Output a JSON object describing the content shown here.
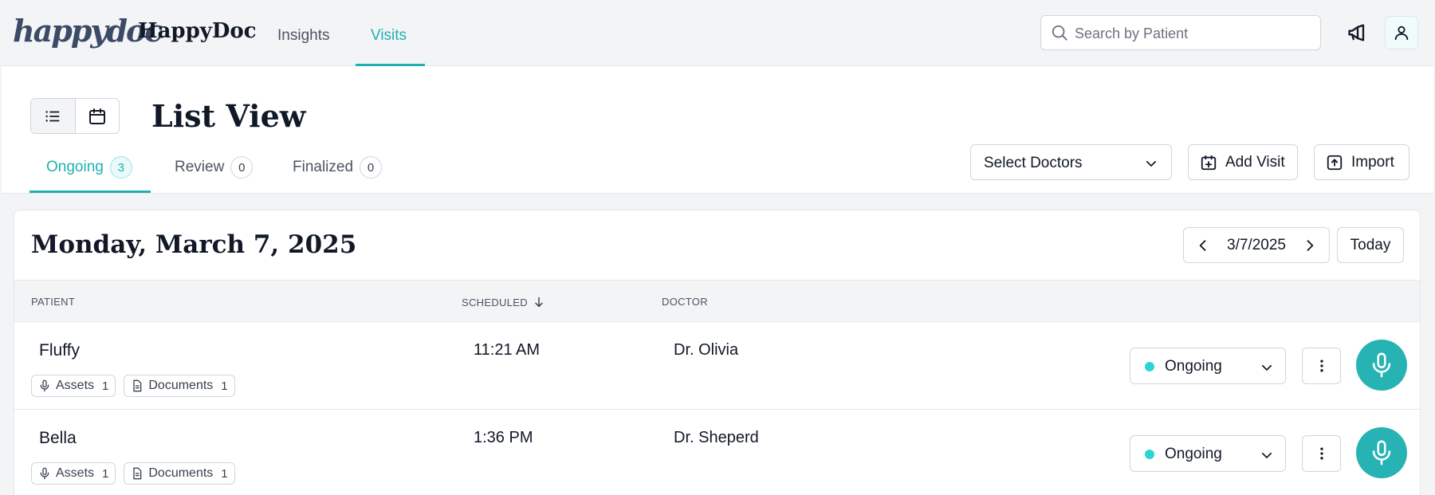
{
  "nav": {
    "logo": "happydoc",
    "brand": "HappyDoc",
    "tabs": [
      {
        "label": "Insights"
      },
      {
        "label": "Visits"
      }
    ],
    "search_placeholder": "Search by Patient"
  },
  "header": {
    "title": "List View",
    "tabs": [
      {
        "label": "Ongoing",
        "count": "3"
      },
      {
        "label": "Review",
        "count": "0"
      },
      {
        "label": "Finalized",
        "count": "0"
      }
    ],
    "select_doctors": "Select Doctors",
    "add_visit": "Add Visit",
    "import": "Import"
  },
  "day": {
    "title": "Monday, March 7, 2025",
    "date": "3/7/2025",
    "today": "Today"
  },
  "table": {
    "columns": {
      "patient": "PATIENT",
      "scheduled": "SCHEDULED",
      "doctor": "DOCTOR"
    },
    "rows": [
      {
        "patient": "Fluffy",
        "assets_label": "Assets",
        "assets": "1",
        "documents_label": "Documents",
        "documents": "1",
        "time": "11:21 AM",
        "doctor": "Dr. Olivia",
        "status": "Ongoing"
      },
      {
        "patient": "Bella",
        "assets_label": "Assets",
        "assets": "1",
        "documents_label": "Documents",
        "documents": "1",
        "time": "1:36 PM",
        "doctor": "Dr. Sheperd",
        "status": "Ongoing"
      }
    ]
  },
  "colors": {
    "accent": "#1fb1b1",
    "mic": "#27b3b3",
    "status_dot": "#2dd4d4"
  }
}
